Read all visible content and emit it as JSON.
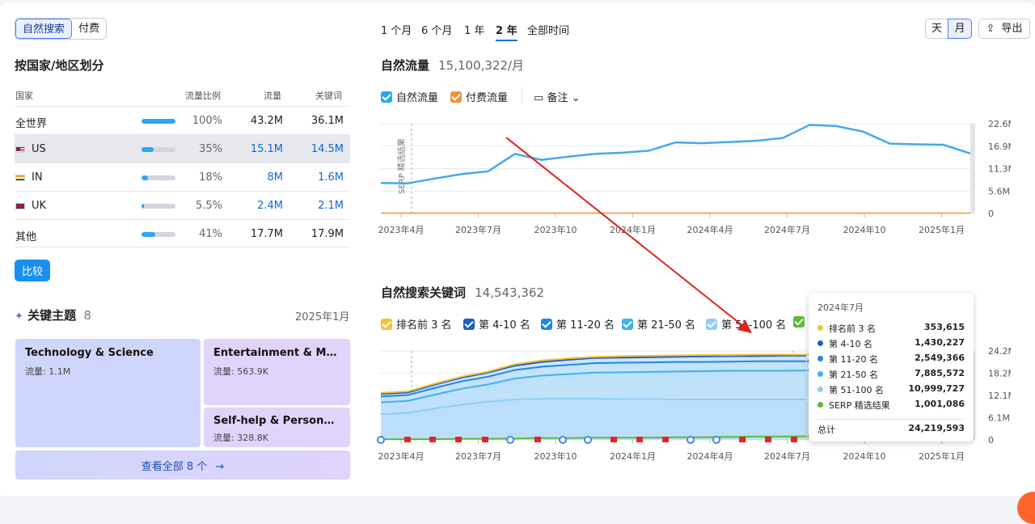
{
  "filters": {
    "organic": "自然搜索",
    "paid": "付费"
  },
  "country_section": {
    "title": "按国家/地区划分",
    "headers": {
      "country": "国家",
      "share": "流量比例",
      "traffic": "流量",
      "keywords": "关键词"
    },
    "rows": [
      {
        "name": "全世界",
        "share": "100%",
        "share_value": 100,
        "traffic": "43.2M",
        "keywords": "36.1M"
      },
      {
        "name": "US",
        "share": "35%",
        "share_value": 35,
        "traffic": "15.1M",
        "keywords": "14.5M"
      },
      {
        "name": "IN",
        "share": "18%",
        "share_value": 18,
        "traffic": "8M",
        "keywords": "1.6M"
      },
      {
        "name": "UK",
        "share": "5.5%",
        "share_value": 5.5,
        "traffic": "2.4M",
        "keywords": "2.1M"
      },
      {
        "name": "其他",
        "share": "41%",
        "share_value": 41,
        "traffic": "17.7M",
        "keywords": "17.9M"
      }
    ],
    "compare_label": "比较"
  },
  "topics": {
    "title": "关键主题",
    "count": "8",
    "date": "2025年1月",
    "items": [
      {
        "name": "Technology & Science",
        "traffic": "流量:  1.1M"
      },
      {
        "name": "Entertainment & Media",
        "traffic": "流量:  563.9K"
      },
      {
        "name": "Self-help & Personal D...",
        "traffic": "流量:  328.8K"
      }
    ],
    "view_all": "查看全部 8 个"
  },
  "periods": [
    "1 个月",
    "6 个月",
    "1 年",
    "2 年",
    "全部时间"
  ],
  "granularity": {
    "day": "天",
    "month": "月"
  },
  "export_label": "导出",
  "traffic_chart": {
    "title": "自然流量",
    "value": "15,100,322/月",
    "legend": {
      "organic": "自然流量",
      "paid": "付费流量",
      "notes": "备注"
    },
    "serp_label": "SERP 精选结果",
    "y_ticks": [
      "22.6M",
      "16.9M",
      "11.3M",
      "5.6M",
      "0"
    ],
    "x_ticks": [
      "2023年4月",
      "2023年7月",
      "2023年10",
      "2024年1月",
      "2024年4月",
      "2024年7月",
      "2024年10",
      "2025年1月"
    ]
  },
  "keywords_chart": {
    "title": "自然搜索关键词",
    "value": "14,543,362",
    "legend": [
      "排名前 3 名",
      "第 4-10 名",
      "第 11-20 名",
      "第 21-50 名",
      "第 51-100 名"
    ],
    "y_ticks": [
      "24.2M",
      "18.2M",
      "12.1M",
      "6.1M",
      "0"
    ],
    "x_ticks": [
      "2023年4月",
      "2023年7月",
      "2023年10",
      "2024年1月",
      "2024年4月",
      "2024年7月",
      "2024年10",
      "2025年1月"
    ]
  },
  "tooltip": {
    "date": "2024年7月",
    "rows": [
      {
        "name": "排名前 3 名",
        "value": "353,615",
        "color": "#f5c234"
      },
      {
        "name": "第 4-10 名",
        "value": "1,430,227",
        "color": "#1a5ec4"
      },
      {
        "name": "第 11-20 名",
        "value": "2,549,366",
        "color": "#1f86e8"
      },
      {
        "name": "第 21-50 名",
        "value": "7,885,572",
        "color": "#3fb0f4"
      },
      {
        "name": "第 51-100 名",
        "value": "10,999,727",
        "color": "#92cdf6"
      },
      {
        "name": "SERP 精选结果",
        "value": "1,001,086",
        "color": "#5dba3b"
      }
    ],
    "total_label": "总计",
    "total_value": "24,219,593"
  },
  "chart_data": [
    {
      "type": "line",
      "title": "自然流量",
      "x": [
        "2023-03",
        "2023-04",
        "2023-05",
        "2023-06",
        "2023-07",
        "2023-08",
        "2023-09",
        "2023-10",
        "2023-11",
        "2023-12",
        "2024-01",
        "2024-02",
        "2024-03",
        "2024-04",
        "2024-05",
        "2024-06",
        "2024-07",
        "2024-08",
        "2024-09",
        "2024-10",
        "2024-11",
        "2024-12",
        "2025-01"
      ],
      "series": [
        {
          "name": "自然流量",
          "values": [
            7.7,
            7.6,
            8.8,
            9.9,
            10.6,
            15.0,
            13.5,
            14.3,
            15.0,
            15.3,
            15.8,
            17.9,
            17.7,
            18.0,
            18.3,
            19.0,
            22.3,
            22.0,
            20.6,
            17.6,
            17.4,
            17.3,
            15.1
          ]
        },
        {
          "name": "付费流量",
          "values": [
            0.1,
            0.1,
            0.1,
            0.1,
            0.1,
            0.1,
            0.1,
            0.1,
            0.1,
            0.1,
            0.1,
            0.1,
            0.1,
            0.1,
            0.1,
            0.1,
            0.1,
            0.1,
            0.1,
            0.1,
            0.1,
            0.1,
            0.1
          ]
        }
      ],
      "ylim": [
        0,
        22.6
      ]
    },
    {
      "type": "area",
      "title": "自然搜索关键词",
      "x": [
        "2023-03",
        "2023-04",
        "2023-05",
        "2023-06",
        "2023-07",
        "2023-08",
        "2023-09",
        "2023-10",
        "2023-11",
        "2023-12",
        "2024-01",
        "2024-02",
        "2024-03",
        "2024-04",
        "2024-05",
        "2024-06",
        "2024-07",
        "2024-08",
        "2024-09",
        "2024-10",
        "2024-11",
        "2024-12",
        "2025-01"
      ],
      "series": [
        {
          "name": "第 51-100 名",
          "values": [
            7.0,
            7.3,
            8.5,
            9.6,
            10.4,
            11.0,
            11.2,
            11.2,
            11.2,
            11.1,
            11.1,
            11.0,
            11.0,
            11.0,
            11.0,
            11.0,
            11.0,
            11.0,
            11.0,
            11.0,
            11.0,
            11.0,
            11.0
          ]
        },
        {
          "name": "第 21-50 名",
          "values": [
            10.2,
            10.6,
            12.3,
            13.9,
            15.1,
            16.7,
            17.5,
            17.9,
            18.3,
            18.4,
            18.5,
            18.6,
            18.7,
            18.8,
            18.8,
            18.8,
            18.9,
            18.9,
            18.9,
            18.9,
            18.9,
            18.9,
            18.9
          ]
        },
        {
          "name": "第 11-20 名",
          "values": [
            11.8,
            12.2,
            14.1,
            15.9,
            17.2,
            19.0,
            19.9,
            20.4,
            20.9,
            21.0,
            21.1,
            21.2,
            21.2,
            21.3,
            21.4,
            21.4,
            21.4,
            21.4,
            21.4,
            21.4,
            21.4,
            21.4,
            21.4
          ]
        },
        {
          "name": "第 4-10 名",
          "values": [
            12.5,
            12.9,
            15.0,
            16.9,
            18.3,
            20.2,
            21.2,
            21.8,
            22.3,
            22.4,
            22.5,
            22.6,
            22.7,
            22.8,
            22.8,
            22.9,
            22.9,
            22.9,
            22.9,
            22.9,
            22.9,
            22.9,
            22.9
          ]
        },
        {
          "name": "排名前 3 名",
          "values": [
            12.8,
            13.2,
            15.3,
            17.2,
            18.6,
            20.6,
            21.6,
            22.2,
            22.6,
            22.8,
            22.9,
            23.0,
            23.1,
            23.1,
            23.2,
            23.2,
            23.2,
            23.2,
            23.2,
            23.2,
            23.2,
            23.2,
            23.2
          ]
        },
        {
          "name": "SERP 精选结果",
          "values": [
            0.2,
            0.2,
            0.2,
            0.3,
            0.3,
            0.4,
            0.5,
            0.5,
            0.6,
            0.6,
            0.6,
            0.7,
            0.7,
            0.8,
            0.9,
            0.9,
            1.0,
            1.0,
            1.0,
            1.0,
            1.0,
            1.0,
            1.0
          ]
        }
      ],
      "ylim": [
        0,
        24.2
      ]
    }
  ]
}
